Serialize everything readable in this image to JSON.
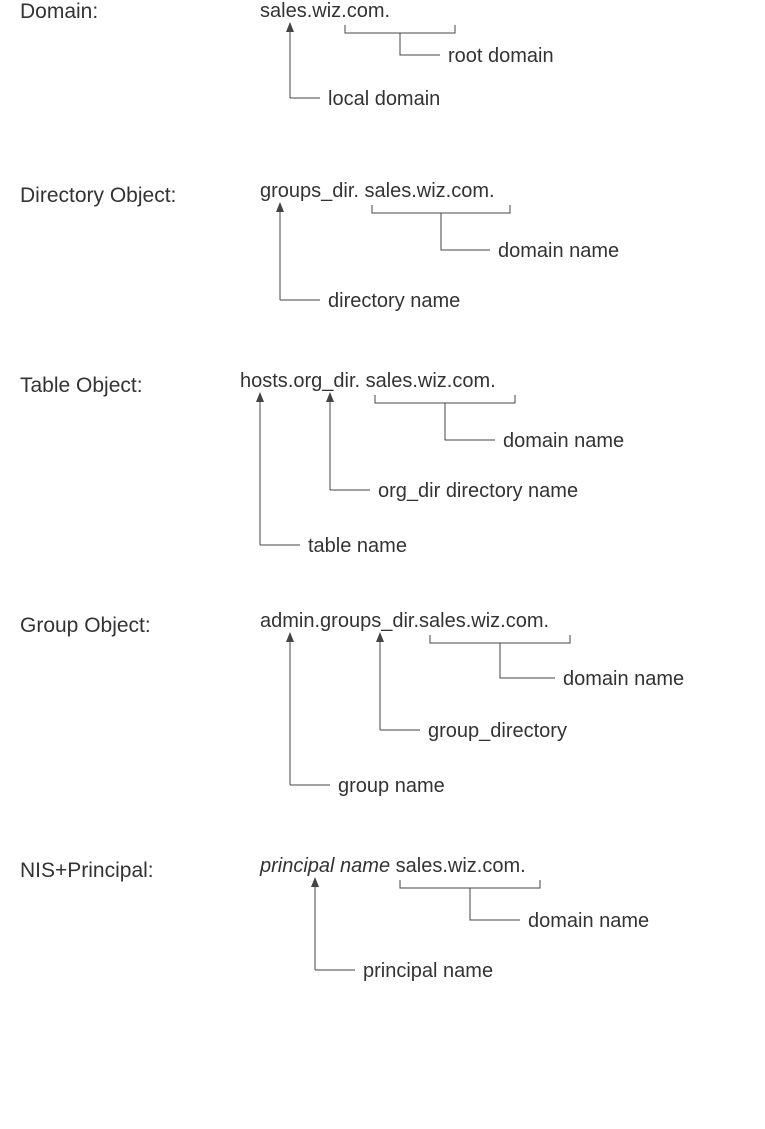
{
  "sections": {
    "domain": {
      "label": "Domain:",
      "code_local": "sales.wiz",
      "code_root": ".com.",
      "annotation_root": "root domain",
      "annotation_local": "local domain"
    },
    "directory": {
      "label": "Directory Object:",
      "code_dir": "groups_dir.",
      "code_domain": "sales.wiz.com.",
      "annotation_domain": "domain name",
      "annotation_dir": "directory name"
    },
    "table": {
      "label": "Table Object:",
      "code_table": "hosts",
      "code_org": ".org_dir.",
      "code_domain": "sales.wiz.com.",
      "annotation_domain": "domain name",
      "annotation_org": "org_dir directory name",
      "annotation_table": "table name"
    },
    "group": {
      "label": "Group Object:",
      "code_group": "admin",
      "code_gdir": ".groups_dir.",
      "code_domain": "sales.wiz.com.",
      "annotation_domain": "domain name",
      "annotation_gdir": "group_directory",
      "annotation_group": "group name"
    },
    "principal": {
      "label": "NIS+Principal:",
      "code_pname": "principal name",
      "code_domain": "sales.wiz.com.",
      "annotation_domain": "domain name",
      "annotation_pname": "principal name"
    }
  }
}
